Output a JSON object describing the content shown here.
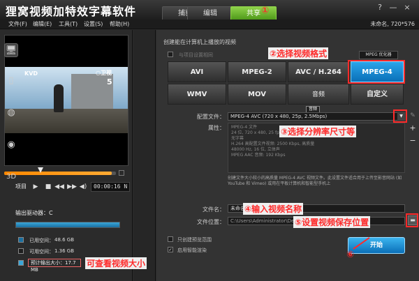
{
  "app": {
    "title": "狸窝视频加特效字幕软件",
    "tabs": [
      "捕获",
      "编辑",
      "共享"
    ],
    "active_tab": "共享",
    "window_buttons": [
      "?",
      "—",
      "×"
    ],
    "project_info": "未命名, 720*576"
  },
  "menu": [
    "文件(F)",
    "编辑(E)",
    "工具(T)",
    "设置(S)",
    "帮助(H)"
  ],
  "preview": {
    "logo_left": "KVD",
    "logo_right": "○卫视",
    "channel": "5",
    "project_label": "项目",
    "timecode": "00:00:16 N"
  },
  "drive": {
    "label": "输出驱动器：C",
    "used_fill": 0.98,
    "legend": [
      {
        "label": "已用空间：",
        "value": "48.6 GB",
        "color": "#1a6fa0"
      },
      {
        "label": "可用空间：",
        "value": "1.36 GB",
        "color": "#1e1e1e"
      },
      {
        "label": "预计输出大小：",
        "value": "17.7 MB",
        "color": "#3aa6d8"
      }
    ]
  },
  "share": {
    "section_title": "创建能在计算机上播放的视频",
    "hidden_checkbox_label": "与项目设置相同",
    "mpeg_optimizer": "MPEG 优化器",
    "formats": [
      "AVI",
      "MPEG-2",
      "AVC / H.264",
      "MPEG-4",
      "WMV",
      "MOV",
      "音频",
      "自定义"
    ],
    "selected_format": "MPEG-4",
    "tooltip": "音频",
    "profile_label": "配置文件：",
    "profile_value": "MPEG-4 AVC (720 x 480, 25p, 2.5Mbps)",
    "props_label": "属性：",
    "properties": [
      "MPEG-4 文件",
      "24 位, 720 x 480, 25 fps",
      "无字幕",
      "H.264 高配置文件视频: 2500 Kbps, 高质量",
      "48000 Hz, 16 位, 立体声",
      "MPEG AAC 音频: 192 Kbps"
    ],
    "description": "创建文件大小较小的高质量 MPEG-4 AVC 视频文件。此设置文件适合用于上传至影音网站 (如 YouTube 和 Vimeo) 或用在平板计算机和智能型手机上",
    "filename_label": "文件名：",
    "filename_value": "未命名",
    "location_label": "文件位置：",
    "location_value": "C:\\Users\\Administrator\\Desktop\\",
    "check_preview_only": "只创建预览范围",
    "check_smart_render": "启用智能渲染",
    "start_button": "开始"
  },
  "annotations": {
    "a1": "①",
    "a2": "②选择视频格式",
    "a3": "③选择分辨率尺寸等",
    "a4": "④输入视频名称",
    "a5": "⑤设置视频保存位置",
    "a6": "⑥",
    "size_note": "可查看视频大小"
  }
}
